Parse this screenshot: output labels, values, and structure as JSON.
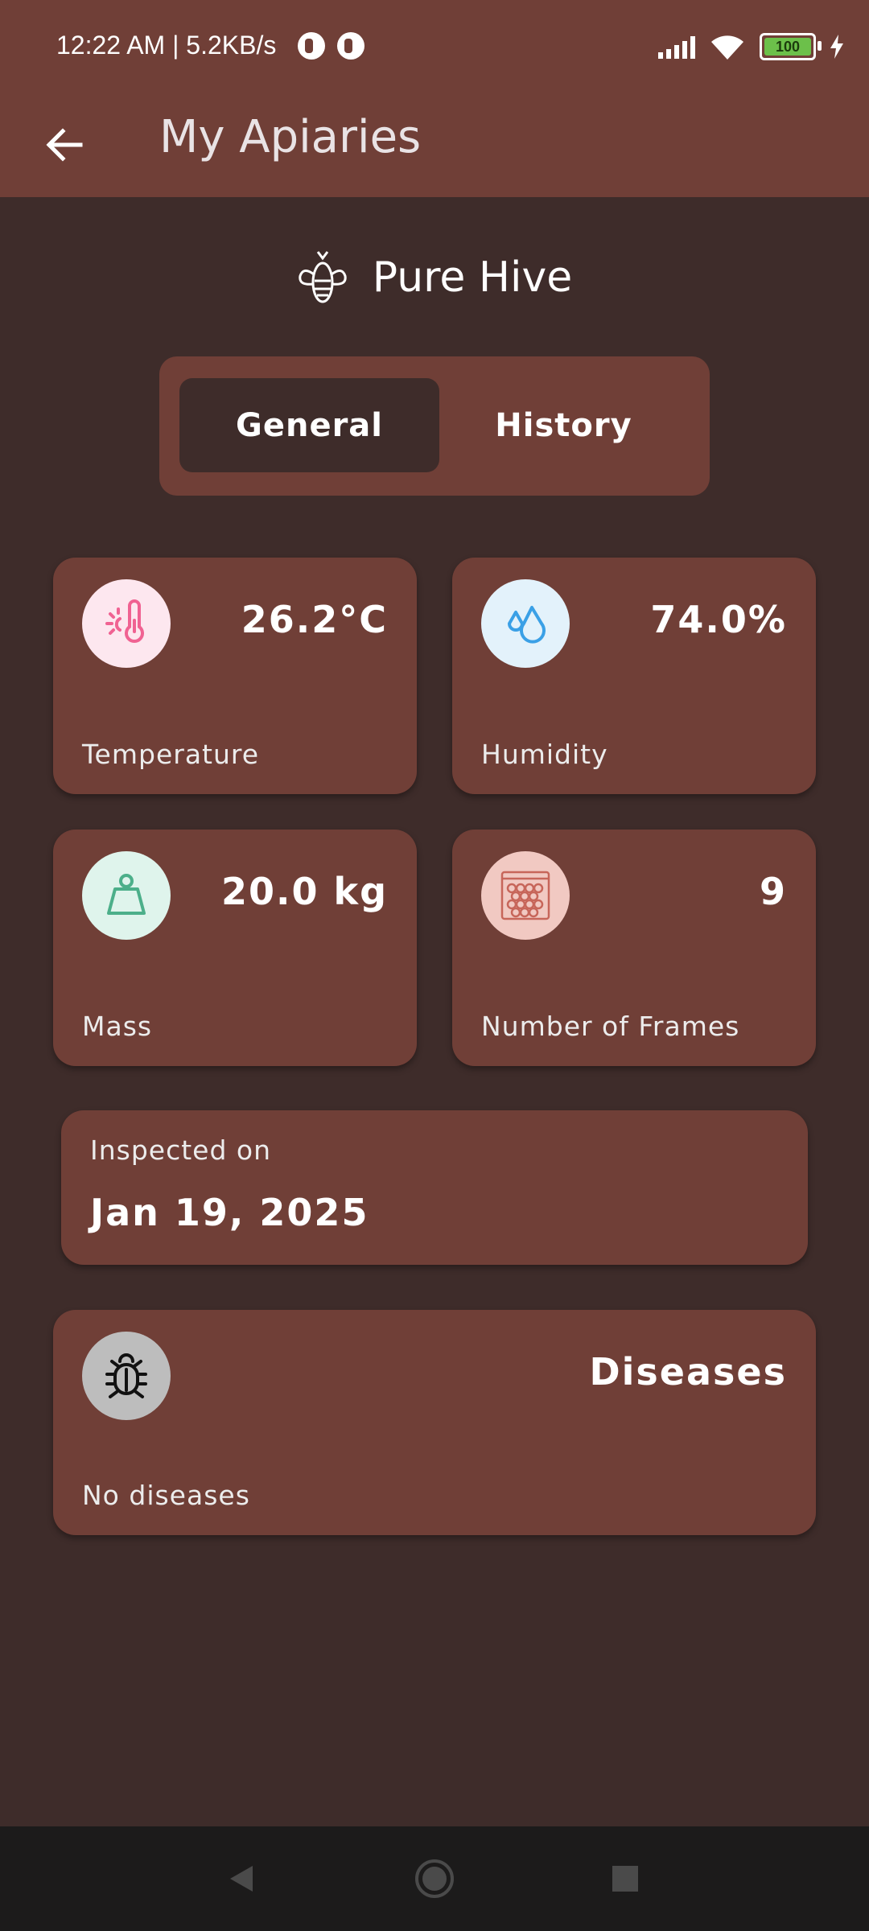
{
  "status": {
    "time_speed": "12:22 AM | 5.2KB/s",
    "battery": "100"
  },
  "appbar": {
    "title": "My Apiaries",
    "back_icon": "arrow-left-icon"
  },
  "hive": {
    "name": "Pure Hive",
    "icon": "bee-icon"
  },
  "tabs": [
    {
      "label": "General",
      "active": true
    },
    {
      "label": "History",
      "active": false
    }
  ],
  "metrics": {
    "temperature": {
      "value": "26.2°C",
      "label": "Temperature",
      "icon": "thermometer-sun-icon",
      "color": "#f06292",
      "bg": "#fde7ef"
    },
    "humidity": {
      "value": "74.0%",
      "label": "Humidity",
      "icon": "water-drops-icon",
      "color": "#3aa0e6",
      "bg": "#e3f2fb"
    },
    "mass": {
      "value": "20.0 kg",
      "label": "Mass",
      "icon": "weight-icon",
      "color": "#4caf8a",
      "bg": "#dff4ec"
    },
    "frames": {
      "value": "9",
      "label": "Number of Frames",
      "icon": "honeycomb-frame-icon",
      "color": "#c7665a",
      "bg": "#f1c9c2"
    }
  },
  "inspection": {
    "label": "Inspected on",
    "date": "Jan 19, 2025"
  },
  "diseases": {
    "title": "Diseases",
    "status": "No diseases",
    "icon": "bug-icon"
  },
  "colors": {
    "background": "#3e2c2a",
    "card": "#703f37",
    "appbar": "#703f37",
    "navbar": "#1c1b1b"
  }
}
